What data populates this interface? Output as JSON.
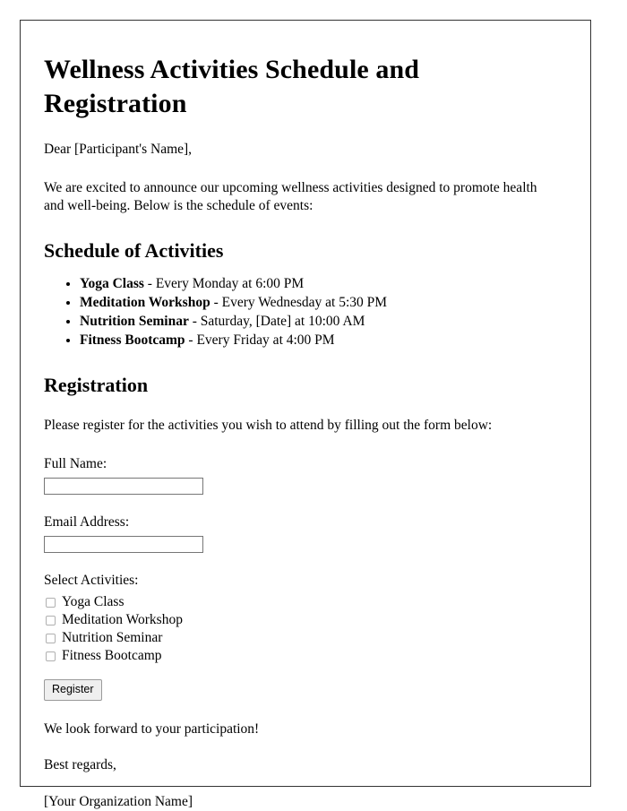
{
  "document": {
    "title": "Wellness Activities Schedule and Registration",
    "salutation": "Dear [Participant's Name],",
    "intro": "We are excited to announce our upcoming wellness activities designed to promote health and well-being. Below is the schedule of events:"
  },
  "schedule": {
    "heading": "Schedule of Activities",
    "items": [
      {
        "name": "Yoga Class",
        "details": " - Every Monday at 6:00 PM"
      },
      {
        "name": "Meditation Workshop",
        "details": " - Every Wednesday at 5:30 PM"
      },
      {
        "name": "Nutrition Seminar",
        "details": " - Saturday, [Date] at 10:00 AM"
      },
      {
        "name": "Fitness Bootcamp",
        "details": " - Every Friday at 4:00 PM"
      }
    ]
  },
  "registration": {
    "heading": "Registration",
    "instructions": "Please register for the activities you wish to attend by filling out the form below:",
    "form": {
      "full_name_label": "Full Name:",
      "full_name_value": "",
      "full_name_placeholder": "",
      "email_label": "Email Address:",
      "email_value": "",
      "email_placeholder": "",
      "select_activities_label": "Select Activities:",
      "checkboxes": [
        {
          "label": "Yoga Class",
          "checked": false
        },
        {
          "label": "Meditation Workshop",
          "checked": false
        },
        {
          "label": "Nutrition Seminar",
          "checked": false
        },
        {
          "label": "Fitness Bootcamp",
          "checked": false
        }
      ],
      "submit_label": "Register"
    }
  },
  "closing": {
    "line1": "We look forward to your participation!",
    "line2": "Best regards,",
    "line3": "[Your Organization Name]"
  }
}
